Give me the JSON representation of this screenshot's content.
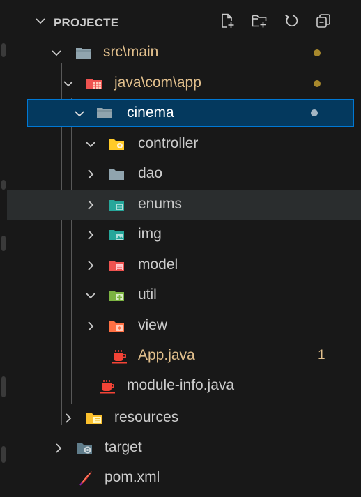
{
  "explorer": {
    "title": "PROJECTE",
    "actions": [
      {
        "name": "new-file-icon"
      },
      {
        "name": "new-folder-icon"
      },
      {
        "name": "refresh-icon"
      },
      {
        "name": "collapse-all-icon"
      }
    ]
  },
  "tree": {
    "src_main": {
      "label": "src\\main",
      "icon": "folder-icon",
      "expanded": true,
      "status": "modified"
    },
    "java_com_app": {
      "label": "java\\com\\app",
      "icon": "java-folder-icon",
      "expanded": true,
      "status": "modified"
    },
    "cinema": {
      "label": "cinema",
      "icon": "folder-icon",
      "expanded": true,
      "status": "untracked",
      "selected": true
    },
    "controller": {
      "label": "controller",
      "icon": "controller-folder-icon",
      "expanded": true
    },
    "dao": {
      "label": "dao",
      "icon": "folder-icon",
      "expanded": false
    },
    "enums": {
      "label": "enums",
      "icon": "enums-folder-icon",
      "expanded": false,
      "hovered": true
    },
    "img": {
      "label": "img",
      "icon": "image-folder-icon",
      "expanded": false
    },
    "model": {
      "label": "model",
      "icon": "model-folder-icon",
      "expanded": false
    },
    "util": {
      "label": "util",
      "icon": "util-folder-icon",
      "expanded": true
    },
    "view": {
      "label": "view",
      "icon": "view-folder-icon",
      "expanded": false
    },
    "app_java": {
      "label": "App.java",
      "icon": "java-file-icon",
      "count": "1",
      "status": "modified"
    },
    "module_info": {
      "label": "module-info.java",
      "icon": "java-file-icon"
    },
    "resources": {
      "label": "resources",
      "icon": "resources-folder-icon",
      "expanded": false
    },
    "target": {
      "label": "target",
      "icon": "target-folder-icon",
      "expanded": false
    },
    "pom_xml": {
      "label": "pom.xml",
      "icon": "maven-file-icon"
    }
  },
  "colors": {
    "background": "#181818",
    "selection": "#04395e",
    "selection_border": "#0078d4",
    "hover": "#2a2d2e",
    "text": "#cccccc",
    "modified": "#e2c08d",
    "modified_dot": "#a7882c",
    "untracked_dot": "#a4b6c4"
  }
}
